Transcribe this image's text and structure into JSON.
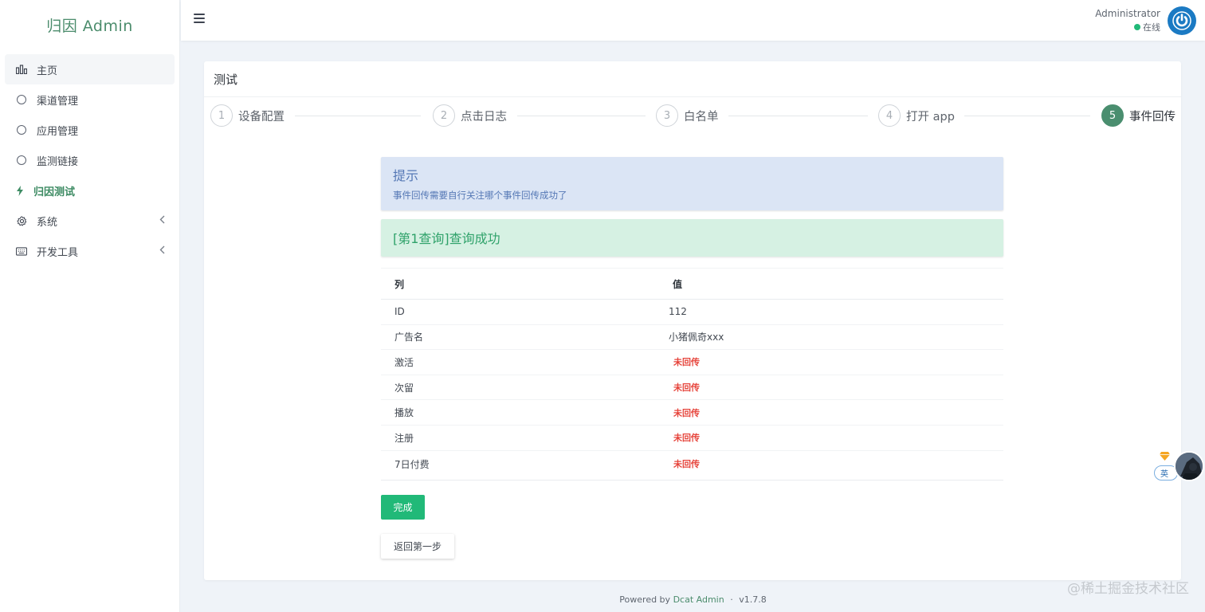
{
  "brand": {
    "title": "归因 Admin"
  },
  "sidebar": {
    "items": [
      {
        "label": "主页",
        "icon": "bar-chart-icon"
      },
      {
        "label": "渠道管理",
        "icon": "circle-icon"
      },
      {
        "label": "应用管理",
        "icon": "circle-icon"
      },
      {
        "label": "监测链接",
        "icon": "circle-icon"
      },
      {
        "label": "归因测试",
        "icon": "bolt-icon"
      },
      {
        "label": "系统",
        "icon": "gear-icon"
      },
      {
        "label": "开发工具",
        "icon": "keyboard-icon"
      }
    ]
  },
  "navbar": {
    "user_name": "Administrator",
    "user_status": "在线"
  },
  "card": {
    "title": "测试"
  },
  "steps": [
    {
      "num": "1",
      "label": "设备配置"
    },
    {
      "num": "2",
      "label": "点击日志"
    },
    {
      "num": "3",
      "label": "白名单"
    },
    {
      "num": "4",
      "label": "打开 app"
    },
    {
      "num": "5",
      "label": "事件回传"
    }
  ],
  "alert_info": {
    "title": "提示",
    "text": "事件回传需要自行关注哪个事件回传成功了"
  },
  "alert_success": {
    "text": "[第1查询]查询成功"
  },
  "table": {
    "headers": {
      "col": "列",
      "val": "值"
    },
    "rows": [
      {
        "key": "ID",
        "value": "112"
      },
      {
        "key": "广告名",
        "value": "小猪佩奇xxx"
      },
      {
        "key": "激活",
        "value": "未回传"
      },
      {
        "key": "次留",
        "value": "未回传"
      },
      {
        "key": "播放",
        "value": "未回传"
      },
      {
        "key": "注册",
        "value": "未回传"
      },
      {
        "key": "7日付费",
        "value": "未回传"
      }
    ]
  },
  "buttons": {
    "done": "完成",
    "back": "返回第一步"
  },
  "footer": {
    "prefix": "Powered by",
    "link": "Dcat Admin",
    "sep": "·",
    "version": "v1.7.8"
  },
  "watermark": "@稀土掘金技术社区",
  "floating": {
    "pill": "英"
  },
  "colors": {
    "brand": "#4b8c6c",
    "success": "#21b978",
    "danger": "#e6443b",
    "info_bg": "#dbe5f5",
    "success_bg": "#d6f1e3",
    "avatar": "#1b7ac3"
  }
}
